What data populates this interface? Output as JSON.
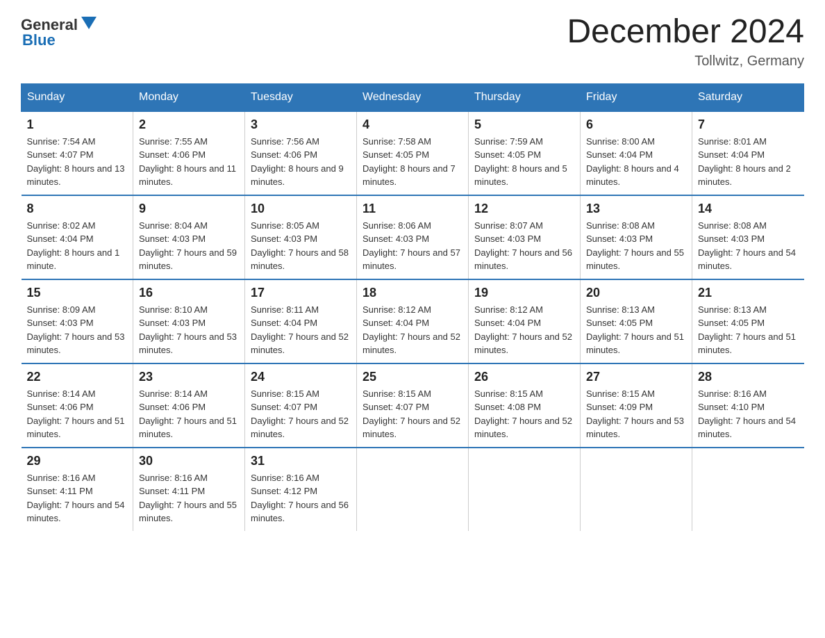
{
  "header": {
    "logo_general": "General",
    "logo_blue": "Blue",
    "title": "December 2024",
    "location": "Tollwitz, Germany"
  },
  "days_of_week": [
    "Sunday",
    "Monday",
    "Tuesday",
    "Wednesday",
    "Thursday",
    "Friday",
    "Saturday"
  ],
  "weeks": [
    [
      {
        "day": "1",
        "sunrise": "7:54 AM",
        "sunset": "4:07 PM",
        "daylight": "8 hours and 13 minutes."
      },
      {
        "day": "2",
        "sunrise": "7:55 AM",
        "sunset": "4:06 PM",
        "daylight": "8 hours and 11 minutes."
      },
      {
        "day": "3",
        "sunrise": "7:56 AM",
        "sunset": "4:06 PM",
        "daylight": "8 hours and 9 minutes."
      },
      {
        "day": "4",
        "sunrise": "7:58 AM",
        "sunset": "4:05 PM",
        "daylight": "8 hours and 7 minutes."
      },
      {
        "day": "5",
        "sunrise": "7:59 AM",
        "sunset": "4:05 PM",
        "daylight": "8 hours and 5 minutes."
      },
      {
        "day": "6",
        "sunrise": "8:00 AM",
        "sunset": "4:04 PM",
        "daylight": "8 hours and 4 minutes."
      },
      {
        "day": "7",
        "sunrise": "8:01 AM",
        "sunset": "4:04 PM",
        "daylight": "8 hours and 2 minutes."
      }
    ],
    [
      {
        "day": "8",
        "sunrise": "8:02 AM",
        "sunset": "4:04 PM",
        "daylight": "8 hours and 1 minute."
      },
      {
        "day": "9",
        "sunrise": "8:04 AM",
        "sunset": "4:03 PM",
        "daylight": "7 hours and 59 minutes."
      },
      {
        "day": "10",
        "sunrise": "8:05 AM",
        "sunset": "4:03 PM",
        "daylight": "7 hours and 58 minutes."
      },
      {
        "day": "11",
        "sunrise": "8:06 AM",
        "sunset": "4:03 PM",
        "daylight": "7 hours and 57 minutes."
      },
      {
        "day": "12",
        "sunrise": "8:07 AM",
        "sunset": "4:03 PM",
        "daylight": "7 hours and 56 minutes."
      },
      {
        "day": "13",
        "sunrise": "8:08 AM",
        "sunset": "4:03 PM",
        "daylight": "7 hours and 55 minutes."
      },
      {
        "day": "14",
        "sunrise": "8:08 AM",
        "sunset": "4:03 PM",
        "daylight": "7 hours and 54 minutes."
      }
    ],
    [
      {
        "day": "15",
        "sunrise": "8:09 AM",
        "sunset": "4:03 PM",
        "daylight": "7 hours and 53 minutes."
      },
      {
        "day": "16",
        "sunrise": "8:10 AM",
        "sunset": "4:03 PM",
        "daylight": "7 hours and 53 minutes."
      },
      {
        "day": "17",
        "sunrise": "8:11 AM",
        "sunset": "4:04 PM",
        "daylight": "7 hours and 52 minutes."
      },
      {
        "day": "18",
        "sunrise": "8:12 AM",
        "sunset": "4:04 PM",
        "daylight": "7 hours and 52 minutes."
      },
      {
        "day": "19",
        "sunrise": "8:12 AM",
        "sunset": "4:04 PM",
        "daylight": "7 hours and 52 minutes."
      },
      {
        "day": "20",
        "sunrise": "8:13 AM",
        "sunset": "4:05 PM",
        "daylight": "7 hours and 51 minutes."
      },
      {
        "day": "21",
        "sunrise": "8:13 AM",
        "sunset": "4:05 PM",
        "daylight": "7 hours and 51 minutes."
      }
    ],
    [
      {
        "day": "22",
        "sunrise": "8:14 AM",
        "sunset": "4:06 PM",
        "daylight": "7 hours and 51 minutes."
      },
      {
        "day": "23",
        "sunrise": "8:14 AM",
        "sunset": "4:06 PM",
        "daylight": "7 hours and 51 minutes."
      },
      {
        "day": "24",
        "sunrise": "8:15 AM",
        "sunset": "4:07 PM",
        "daylight": "7 hours and 52 minutes."
      },
      {
        "day": "25",
        "sunrise": "8:15 AM",
        "sunset": "4:07 PM",
        "daylight": "7 hours and 52 minutes."
      },
      {
        "day": "26",
        "sunrise": "8:15 AM",
        "sunset": "4:08 PM",
        "daylight": "7 hours and 52 minutes."
      },
      {
        "day": "27",
        "sunrise": "8:15 AM",
        "sunset": "4:09 PM",
        "daylight": "7 hours and 53 minutes."
      },
      {
        "day": "28",
        "sunrise": "8:16 AM",
        "sunset": "4:10 PM",
        "daylight": "7 hours and 54 minutes."
      }
    ],
    [
      {
        "day": "29",
        "sunrise": "8:16 AM",
        "sunset": "4:11 PM",
        "daylight": "7 hours and 54 minutes."
      },
      {
        "day": "30",
        "sunrise": "8:16 AM",
        "sunset": "4:11 PM",
        "daylight": "7 hours and 55 minutes."
      },
      {
        "day": "31",
        "sunrise": "8:16 AM",
        "sunset": "4:12 PM",
        "daylight": "7 hours and 56 minutes."
      },
      null,
      null,
      null,
      null
    ]
  ]
}
